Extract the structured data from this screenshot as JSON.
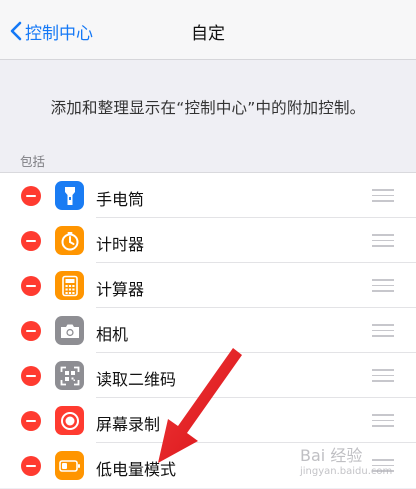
{
  "colors": {
    "accent": "#1478f6",
    "delete": "#ff3b30",
    "flashlight": "#1a7cf3",
    "timer": "#ff9500",
    "calculator": "#ff9500",
    "camera": "#8e8e93",
    "qr": "#8e8e93",
    "record": "#ff3b30",
    "low_power": "#ff9500",
    "annotation_arrow": "#e81e25"
  },
  "nav": {
    "back_label": "控制中心",
    "title": "自定"
  },
  "description": "添加和整理显示在“控制中心”中的附加控制。",
  "section_header": "包括",
  "items": [
    {
      "label": "手电筒",
      "icon": "flashlight-icon"
    },
    {
      "label": "计时器",
      "icon": "timer-icon"
    },
    {
      "label": "计算器",
      "icon": "calculator-icon"
    },
    {
      "label": "相机",
      "icon": "camera-icon"
    },
    {
      "label": "读取二维码",
      "icon": "qr-code-icon"
    },
    {
      "label": "屏幕录制",
      "icon": "screen-record-icon"
    },
    {
      "label": "低电量模式",
      "icon": "battery-icon"
    }
  ],
  "watermark": {
    "line1": "Bai 经验",
    "line2": "jingyan.baidu.com"
  }
}
